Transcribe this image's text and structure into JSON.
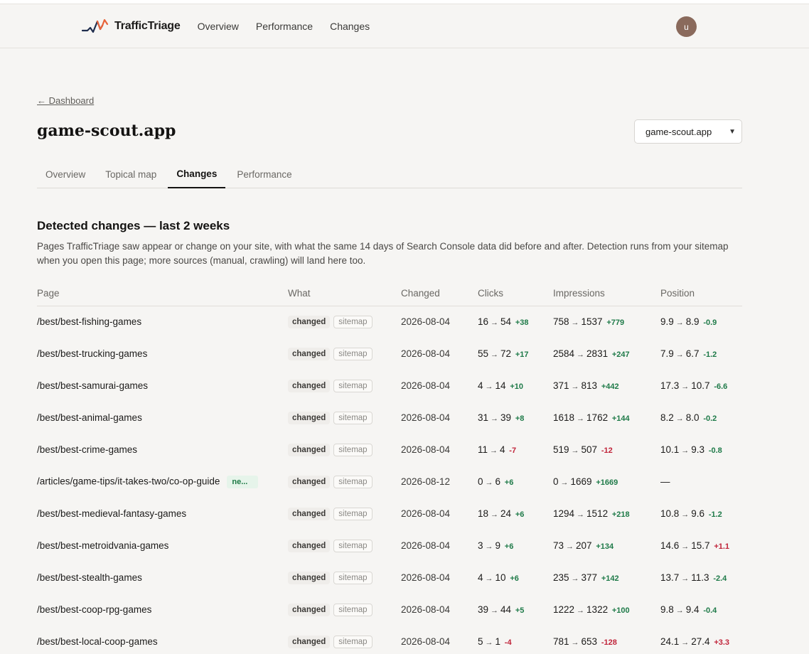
{
  "app": {
    "name": "TrafficTriage",
    "avatar_initial": "u"
  },
  "topnav": [
    "Overview",
    "Performance",
    "Changes"
  ],
  "back_link": "← Dashboard",
  "site": {
    "title": "game-scout.app",
    "selected": "game-scout.app"
  },
  "tabs": [
    {
      "label": "Overview",
      "active": false
    },
    {
      "label": "Topical map",
      "active": false
    },
    {
      "label": "Changes",
      "active": true
    },
    {
      "label": "Performance",
      "active": false
    }
  ],
  "section": {
    "title": "Detected changes — last 2 weeks",
    "description": "Pages TrafficTriage saw appear or change on your site, with what the same 14 days of Search Console data did before and after. Detection runs from your sitemap when you open this page; more sources (manual, crawling) will land here too."
  },
  "columns": [
    "Page",
    "What",
    "Changed",
    "Clicks",
    "Impressions",
    "Position"
  ],
  "arrow": "→",
  "colors": {
    "good": "#1e7a48",
    "bad": "#c0243a",
    "new_bg": "#e6f4ea"
  },
  "rows": [
    {
      "page": "/best/best-fishing-games",
      "badge": "",
      "kind": "changed",
      "source": "sitemap",
      "date": "2026-08-04",
      "clicks": [
        "16",
        "54",
        "+38",
        "good"
      ],
      "impr": [
        "758",
        "1537",
        "+779",
        "good"
      ],
      "pos": [
        "9.9",
        "8.9",
        "-0.9",
        "good"
      ]
    },
    {
      "page": "/best/best-trucking-games",
      "badge": "",
      "kind": "changed",
      "source": "sitemap",
      "date": "2026-08-04",
      "clicks": [
        "55",
        "72",
        "+17",
        "good"
      ],
      "impr": [
        "2584",
        "2831",
        "+247",
        "good"
      ],
      "pos": [
        "7.9",
        "6.7",
        "-1.2",
        "good"
      ]
    },
    {
      "page": "/best/best-samurai-games",
      "badge": "",
      "kind": "changed",
      "source": "sitemap",
      "date": "2026-08-04",
      "clicks": [
        "4",
        "14",
        "+10",
        "good"
      ],
      "impr": [
        "371",
        "813",
        "+442",
        "good"
      ],
      "pos": [
        "17.3",
        "10.7",
        "-6.6",
        "good"
      ]
    },
    {
      "page": "/best/best-animal-games",
      "badge": "",
      "kind": "changed",
      "source": "sitemap",
      "date": "2026-08-04",
      "clicks": [
        "31",
        "39",
        "+8",
        "good"
      ],
      "impr": [
        "1618",
        "1762",
        "+144",
        "good"
      ],
      "pos": [
        "8.2",
        "8.0",
        "-0.2",
        "good"
      ]
    },
    {
      "page": "/best/best-crime-games",
      "badge": "",
      "kind": "changed",
      "source": "sitemap",
      "date": "2026-08-04",
      "clicks": [
        "11",
        "4",
        "-7",
        "bad"
      ],
      "impr": [
        "519",
        "507",
        "-12",
        "bad"
      ],
      "pos": [
        "10.1",
        "9.3",
        "-0.8",
        "good"
      ]
    },
    {
      "page": "/articles/game-tips/it-takes-two/co-op-guide",
      "badge": "ne...",
      "kind": "changed",
      "source": "sitemap",
      "date": "2026-08-12",
      "clicks": [
        "0",
        "6",
        "+6",
        "good"
      ],
      "impr": [
        "0",
        "1669",
        "+1669",
        "good"
      ],
      "pos_empty": "—"
    },
    {
      "page": "/best/best-medieval-fantasy-games",
      "badge": "",
      "kind": "changed",
      "source": "sitemap",
      "date": "2026-08-04",
      "clicks": [
        "18",
        "24",
        "+6",
        "good"
      ],
      "impr": [
        "1294",
        "1512",
        "+218",
        "good"
      ],
      "pos": [
        "10.8",
        "9.6",
        "-1.2",
        "good"
      ]
    },
    {
      "page": "/best/best-metroidvania-games",
      "badge": "",
      "kind": "changed",
      "source": "sitemap",
      "date": "2026-08-04",
      "clicks": [
        "3",
        "9",
        "+6",
        "good"
      ],
      "impr": [
        "73",
        "207",
        "+134",
        "good"
      ],
      "pos": [
        "14.6",
        "15.7",
        "+1.1",
        "bad"
      ]
    },
    {
      "page": "/best/best-stealth-games",
      "badge": "",
      "kind": "changed",
      "source": "sitemap",
      "date": "2026-08-04",
      "clicks": [
        "4",
        "10",
        "+6",
        "good"
      ],
      "impr": [
        "235",
        "377",
        "+142",
        "good"
      ],
      "pos": [
        "13.7",
        "11.3",
        "-2.4",
        "good"
      ]
    },
    {
      "page": "/best/best-coop-rpg-games",
      "badge": "",
      "kind": "changed",
      "source": "sitemap",
      "date": "2026-08-04",
      "clicks": [
        "39",
        "44",
        "+5",
        "good"
      ],
      "impr": [
        "1222",
        "1322",
        "+100",
        "good"
      ],
      "pos": [
        "9.8",
        "9.4",
        "-0.4",
        "good"
      ]
    },
    {
      "page": "/best/best-local-coop-games",
      "badge": "",
      "kind": "changed",
      "source": "sitemap",
      "date": "2026-08-04",
      "clicks": [
        "5",
        "1",
        "-4",
        "bad"
      ],
      "impr": [
        "781",
        "653",
        "-128",
        "bad"
      ],
      "pos": [
        "24.1",
        "27.4",
        "+3.3",
        "bad"
      ]
    }
  ]
}
